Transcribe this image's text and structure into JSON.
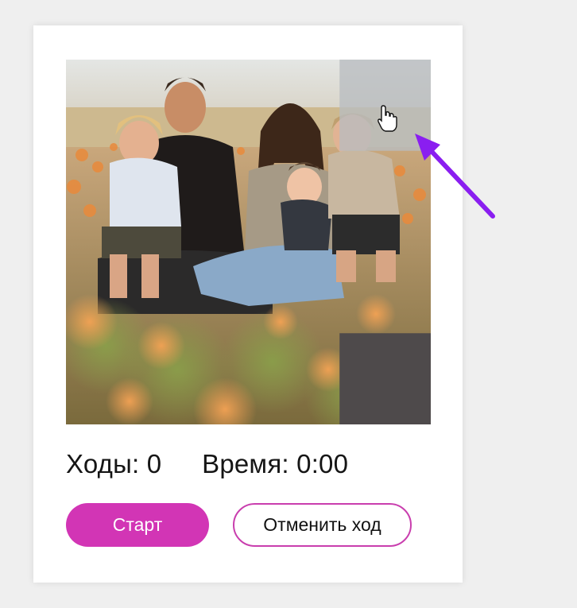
{
  "game": {
    "moves_label": "Ходы:",
    "moves_value": "0",
    "time_label": "Время:",
    "time_value": "0:00"
  },
  "controls": {
    "start_label": "Старт",
    "undo_label": "Отменить ход"
  },
  "puzzle": {
    "grid_size": 4,
    "empty_tile": "bottom-right",
    "hovered_tile": "top-right",
    "image_subject": "family photo in orange flower field"
  },
  "colors": {
    "accent": "#d235b5",
    "accent_border": "#c93eae",
    "empty_tile": "#4e4a4b",
    "hover_overlay": "#b8bcc0",
    "annotation_arrow": "#8a1ef0"
  },
  "icons": {
    "cursor": "hand-pointer-icon",
    "annotation": "arrow-icon"
  }
}
